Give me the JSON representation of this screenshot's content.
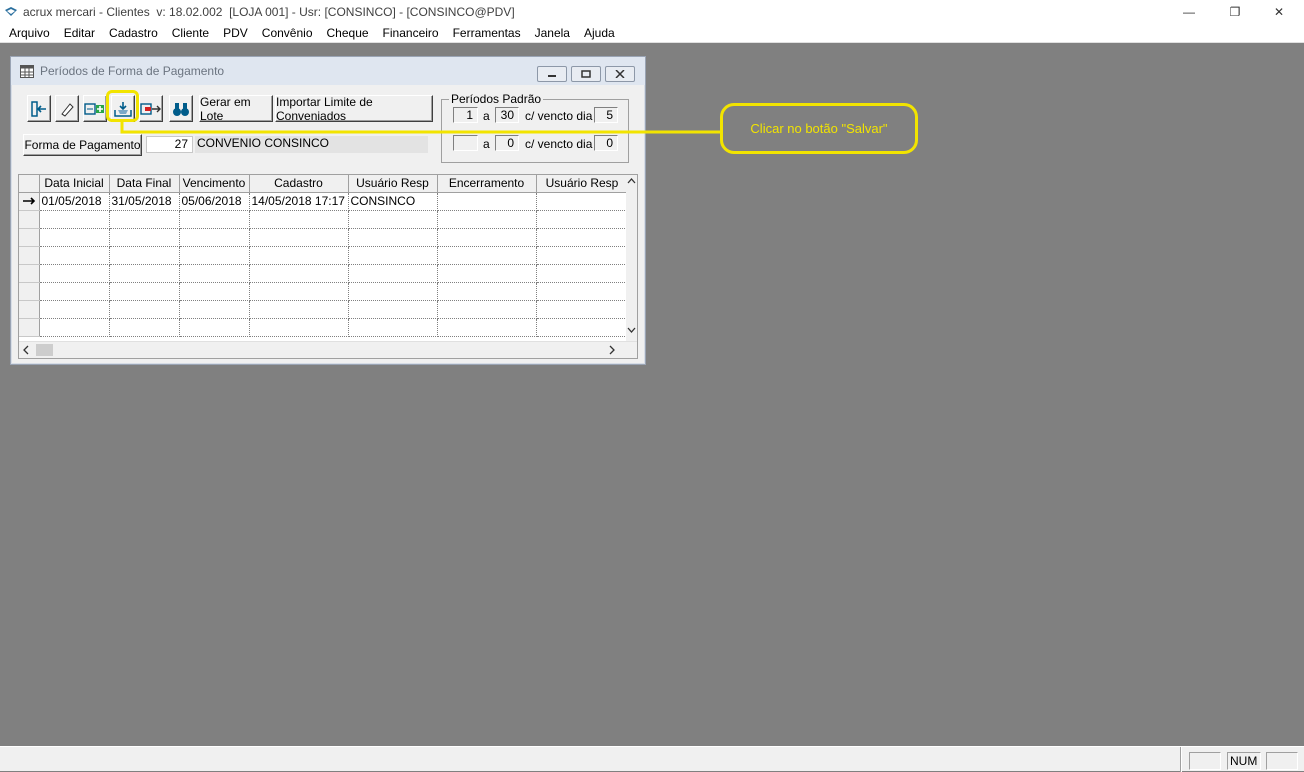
{
  "app": {
    "title": "acrux mercari - Clientes  v: 18.02.002  [LOJA 001] - Usr: [CONSINCO] - [CONSINCO@PDV]"
  },
  "window_controls": {
    "minimize": "—",
    "restore": "❐",
    "close": "✕"
  },
  "menu": [
    "Arquivo",
    "Editar",
    "Cadastro",
    "Cliente",
    "PDV",
    "Convênio",
    "Cheque",
    "Financeiro",
    "Ferramentas",
    "Janela",
    "Ajuda"
  ],
  "mdi": {
    "title": "Períodos de Forma de Pagamento"
  },
  "toolbar": {
    "gerar_lote": "Gerar em Lote",
    "importar_limite": "Importar Limite de Conveniados"
  },
  "periodos": {
    "legend": "Períodos Padrão",
    "row1": {
      "from": "1",
      "sep": "a",
      "to": "30",
      "label": "c/ vencto dia",
      "day": "5"
    },
    "row2": {
      "from": "",
      "sep": "a",
      "to": "0",
      "label": "c/ vencto dia",
      "day": "0"
    }
  },
  "forma": {
    "button": "Forma de Pagamento",
    "code": "27",
    "name": "CONVENIO CONSINCO"
  },
  "grid": {
    "columns": [
      "Data Inicial",
      "Data Final",
      "Vencimento",
      "Cadastro",
      "Usuário Resp",
      "Encerramento",
      "Usuário Resp"
    ],
    "rows": [
      [
        "01/05/2018",
        "31/05/2018",
        "05/06/2018",
        "14/05/2018 17:17",
        "CONSINCO",
        "",
        ""
      ]
    ]
  },
  "callout": {
    "text": "Clicar no botão \"Salvar\""
  },
  "status": {
    "num": "NUM"
  },
  "colors": {
    "highlight": "#f2e400",
    "background": "#808080"
  }
}
